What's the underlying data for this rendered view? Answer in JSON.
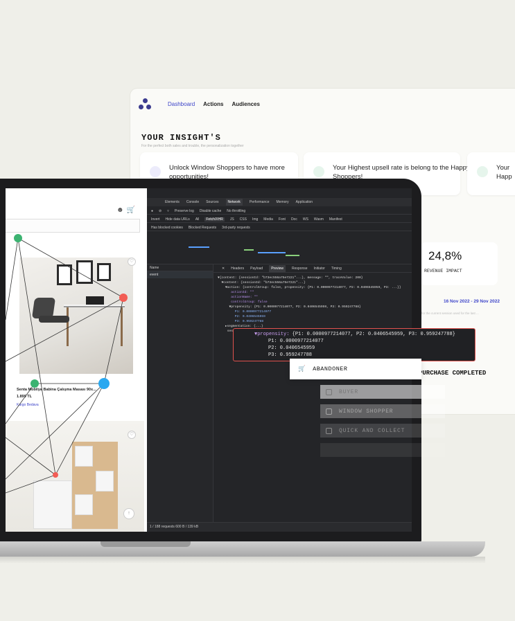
{
  "dashboard": {
    "nav": [
      "Dashboard",
      "Actions",
      "Audiences"
    ],
    "title": "YOUR INSIGHT'S",
    "subtitle": "For the perfect both sales and trouble, the personalization together",
    "cards": [
      {
        "text": "Unlock Window Shoppers to have more opportunities!"
      },
      {
        "text": "Your Highest upsell rate is belong to the Happy Shoppers!"
      },
      {
        "text": "Your Happ"
      }
    ],
    "impact_value": "24,8%",
    "impact_label": "REVENUE IMPACT",
    "date_range": "16 Nov 2022 - 29 Nov 2022",
    "note": "for the current session used for the last ...",
    "purchase_label": "PURCHASE COMPLETED"
  },
  "shop": {
    "product_name": "Senta Mobilya Babina Çalışma Masası 90x...",
    "price": "1.899 TL",
    "link": "Kargo Bedava"
  },
  "devtools": {
    "tabs": [
      "Elements",
      "Console",
      "Sources",
      "Network",
      "Performance",
      "Memory",
      "Application"
    ],
    "active_tab": "Network",
    "toolbar": [
      "Preserve log",
      "Disable cache",
      "No throttling"
    ],
    "filter_row": [
      "Invert",
      "Hide data URLs",
      "All",
      "Fetch/XHR",
      "JS",
      "CSS",
      "Img",
      "Media",
      "Font",
      "Doc",
      "WS",
      "Wasm",
      "Manifest"
    ],
    "option_row": [
      "Has blocked cookies",
      "Blocked Requests",
      "3rd-party requests"
    ],
    "name_header": "Name",
    "request": "event",
    "sub_tabs": [
      "Headers",
      "Payload",
      "Preview",
      "Response",
      "Initiator",
      "Timing"
    ],
    "active_sub_tab": "Preview",
    "status": "1 / 188 requests  600 B / 139 kB",
    "json_lines": [
      "▼{content: {sessionId: \"b73ec556a75e7221\"...}, message: \"\", traceValue: 200}",
      "  ▼content: {sessionId: \"b73ec556a75e7221\"...}",
      "    ▼action: {controlGroup: false, propensity: {P1: 0.0000977214077, P2: 0.0406545959, P3: ...}}",
      "       actionId: \"\"",
      "       actionName: \"\"",
      "       controlGroup: false",
      "      ▼propensity: {P1: 0.0000977214077, P2: 0.0406545959, P3: 0.959247788}",
      "         P1: 0.0000977214077",
      "         P2: 0.0406545959",
      "         P3: 0.959247788",
      "    ▸segmentation: {...}",
      "     sessionId: \"...\""
    ]
  },
  "zoom": {
    "line1_key": "▼propensity:",
    "line1_val": " {P1: 0.0000977214077, P2: 0.0406545959, P3: 0.959247788}",
    "p1": "P1: 0.0000977214077",
    "p2": "P2: 0.0406545959",
    "p3": "P3: 0.959247788"
  },
  "segments": {
    "active": "ABANDONER",
    "items": [
      "BUYER",
      "WINDOW SHOPPER",
      "QUICK AND COLLECT",
      ""
    ]
  },
  "colors": {
    "accent": "#3d44c9",
    "highlight": "#e0524e",
    "node_green": "#3cb371",
    "node_red": "#f25c54",
    "node_blue": "#29a8f0"
  }
}
